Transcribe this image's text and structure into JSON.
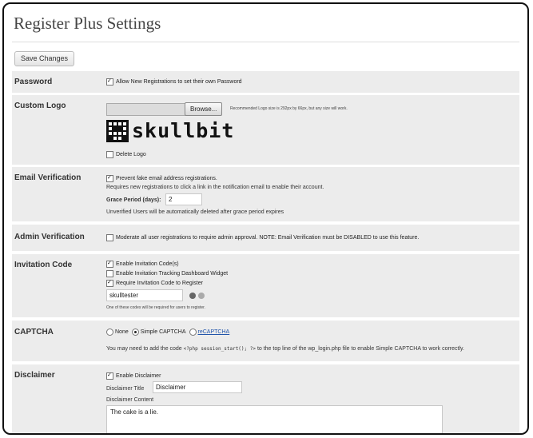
{
  "page": {
    "title": "Register Plus Settings"
  },
  "toolbar": {
    "save_label": "Save Changes"
  },
  "password": {
    "label": "Password",
    "allow_own": "Allow New Registrations to set their own Password"
  },
  "custom_logo": {
    "label": "Custom Logo",
    "browse_label": "Browse...",
    "recommendation": "Recommended Logo size is 292px by 66px, but any size will work.",
    "logo_text": "skullbit",
    "delete_logo": "Delete Logo"
  },
  "email_verification": {
    "label": "Email Verification",
    "prevent_fake": "Prevent fake email address registrations.",
    "requires_text": "Requires new registrations to click a link in the notification email to enable their account.",
    "grace_label": "Grace Period (days):",
    "grace_value": "2",
    "unverified_text": "Unverified Users will be automatically deleted after grace period expires"
  },
  "admin_verification": {
    "label": "Admin Verification",
    "moderate_text": "Moderate all user registrations to require admin approval. NOTE: Email Verification must be DISABLED to use this feature."
  },
  "invitation_code": {
    "label": "Invitation Code",
    "enable_codes": "Enable Invitation Code(s)",
    "enable_widget": "Enable Invitation Tracking Dashboard Widget",
    "require_code": "Require Invitation Code to Register",
    "code_value": "skulltester",
    "note": "One of these codes will be required for users to register."
  },
  "captcha": {
    "label": "CAPTCHA",
    "none": "None",
    "simple": "Simple CAPTCHA",
    "recaptcha": "reCAPTCHA",
    "note_prefix": "You may need to add the code",
    "code": "<?php session_start(); ?>",
    "note_suffix": "to the top line of the wp_login.php file to enable Simple CAPTCHA to work correctly."
  },
  "disclaimer": {
    "label": "Disclaimer",
    "enable": "Enable Disclaimer",
    "title_label": "Disclaimer Title",
    "title_value": "Disclaimer",
    "content_label": "Disclaimer Content",
    "content_value": "The cake is a lie."
  }
}
